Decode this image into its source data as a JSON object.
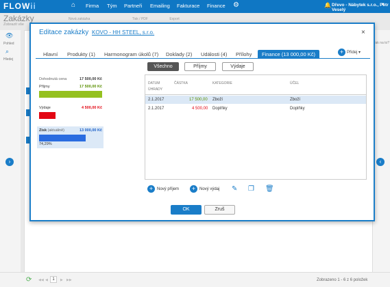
{
  "app": {
    "logo": "FLOW",
    "logo_accent": "ii",
    "user": "Dřevo - Nábytek s.r.o., Petr Veselý"
  },
  "nav": [
    {
      "label": "Firma"
    },
    {
      "label": "Tým"
    },
    {
      "label": "Partneři"
    },
    {
      "label": "Emailing"
    },
    {
      "label": "Fakturace"
    },
    {
      "label": "Finance"
    }
  ],
  "page": {
    "title": "Zakázky",
    "subtitle": "Zobrazit vše",
    "right_hint": "Jak na to?"
  },
  "sidebar": {
    "items": [
      {
        "label": "Pohled"
      },
      {
        "label": "Hledej"
      }
    ]
  },
  "toolbar_bg": {
    "items": [
      "Nová zakázka",
      "Tisk / PDF",
      "Export"
    ]
  },
  "dialog": {
    "title": "Editace zakázky",
    "subtitle": "KOVO - HH STEEL, s.r.o.",
    "close": "×",
    "add_label": "Přidej",
    "tabs": [
      {
        "label": "Hlavní"
      },
      {
        "label": "Produkty (1)"
      },
      {
        "label": "Harmonogram úkolů (7)"
      },
      {
        "label": "Doklady (2)"
      },
      {
        "label": "Události (4)"
      },
      {
        "label": "Přílohy"
      },
      {
        "label": "Finance (13 000,00 Kč)"
      }
    ],
    "filters": [
      {
        "label": "Všechno"
      },
      {
        "label": "Příjmy"
      },
      {
        "label": "Výdaje"
      }
    ],
    "summary": {
      "agreed_label": "Dohodnutá cena",
      "agreed_value": "17 500,00 Kč",
      "income_label": "Příjmy",
      "income_value": "17 500,00 Kč",
      "income_fraction": 1.0,
      "expense_label": "Výdaje",
      "expense_value": "4 500,00 Kč",
      "expense_fraction": 0.257,
      "profit_label": "Zisk",
      "profit_note": "(aktuálně)",
      "profit_value": "13 000,00 Kč",
      "profit_pct": "74,29%",
      "profit_fraction": 0.743
    },
    "table": {
      "headers": [
        "DATUM ÚHRADY",
        "ČÁSTKA",
        "KATEGORIE",
        "ÚČEL"
      ],
      "rows": [
        {
          "date": "2.1.2017",
          "amount": "17 500,00",
          "category": "Zboží",
          "purpose": "Zboží"
        },
        {
          "date": "2.1.2017",
          "amount": "4 500,00",
          "category": "Doplňky",
          "purpose": "Doplňky"
        }
      ]
    },
    "actions": {
      "new_income": "Nový příjem",
      "new_expense": "Nový výdaj"
    },
    "ok": "OK",
    "cancel": "Zruš"
  },
  "pager": {
    "page": "1",
    "status": "Zobrazeno 1 - 6 z 6 položek"
  },
  "colors": {
    "accent": "#1a7dc8",
    "income": "#95c11f",
    "expense": "#e30613",
    "profit": "#2a6ce0"
  }
}
